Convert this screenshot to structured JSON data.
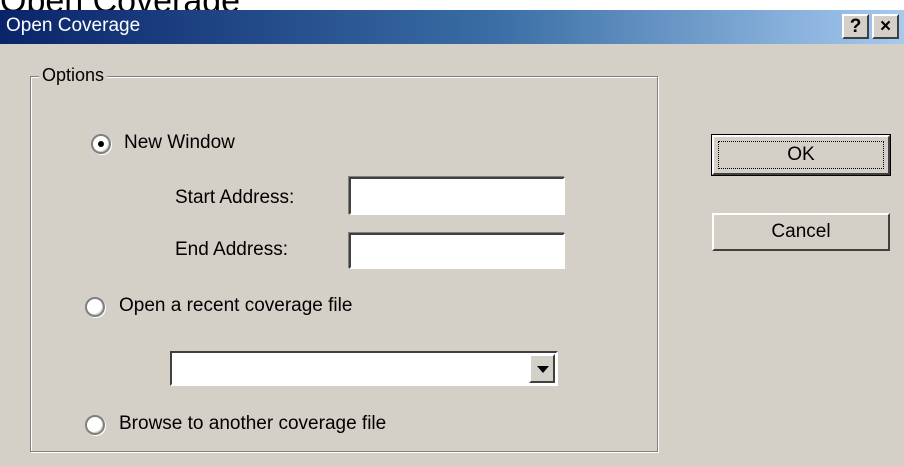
{
  "header_caption": "Open Coverage",
  "window": {
    "title": "Open Coverage",
    "help_glyph": "?",
    "close_glyph": "×"
  },
  "options": {
    "legend": "Options",
    "new_window_label": "New Window",
    "new_window_selected": true,
    "start_address_label": "Start Address:",
    "start_address_value": "",
    "end_address_label": "End Address:",
    "end_address_value": "",
    "recent_label": "Open a recent coverage file",
    "recent_selected": false,
    "recent_value": "",
    "browse_label": "Browse to another coverage file",
    "browse_selected": false
  },
  "buttons": {
    "ok_label": "OK",
    "cancel_label": "Cancel"
  },
  "icons": {
    "help": "help-icon",
    "close": "close-icon",
    "dropdown": "chevron-down-icon"
  }
}
